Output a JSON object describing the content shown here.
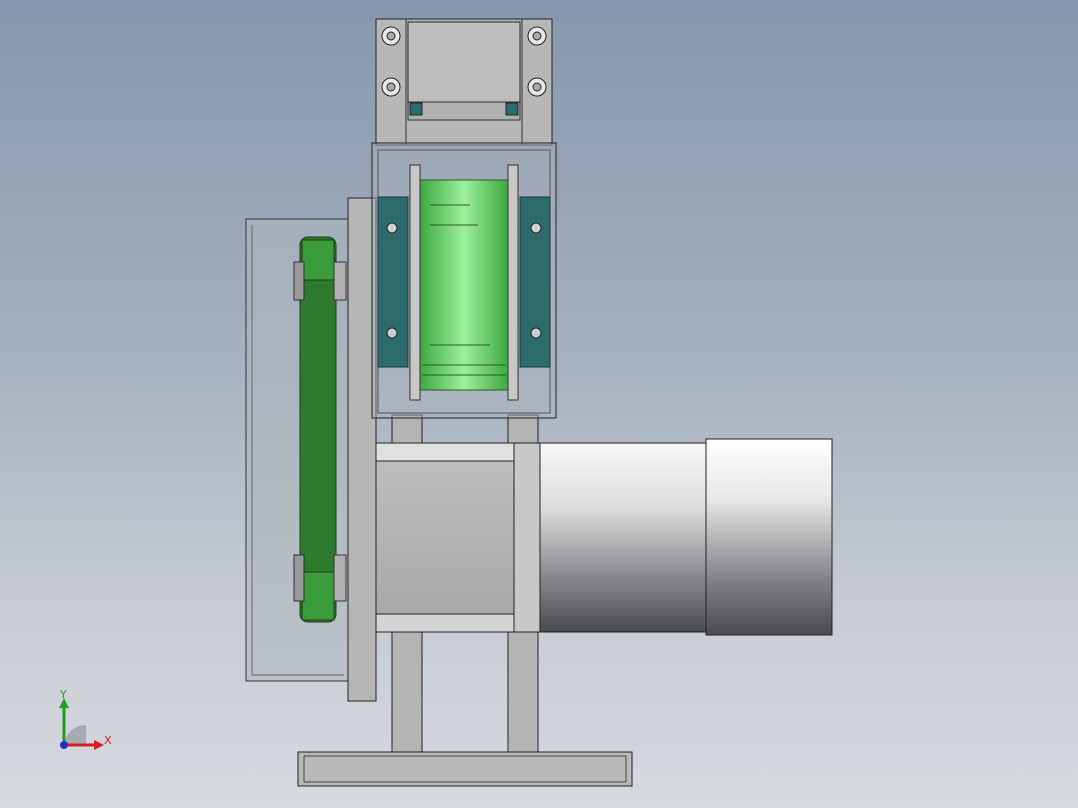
{
  "viewport": {
    "background_top": "#8797ad",
    "background_bottom": "#d6d9de"
  },
  "triad": {
    "x_label": "X",
    "y_label": "Y",
    "x_color": "#d42020",
    "y_color": "#20a020",
    "z_color": "#2030c8"
  },
  "colors": {
    "belt_green": "#2e7d32",
    "pulley_green": "#4fc34f",
    "bracket_teal": "#2e6b6b",
    "steel_gray": "#b3b3b3",
    "motor_light": "#f4f4f4",
    "motor_dark": "#4e4e54"
  }
}
